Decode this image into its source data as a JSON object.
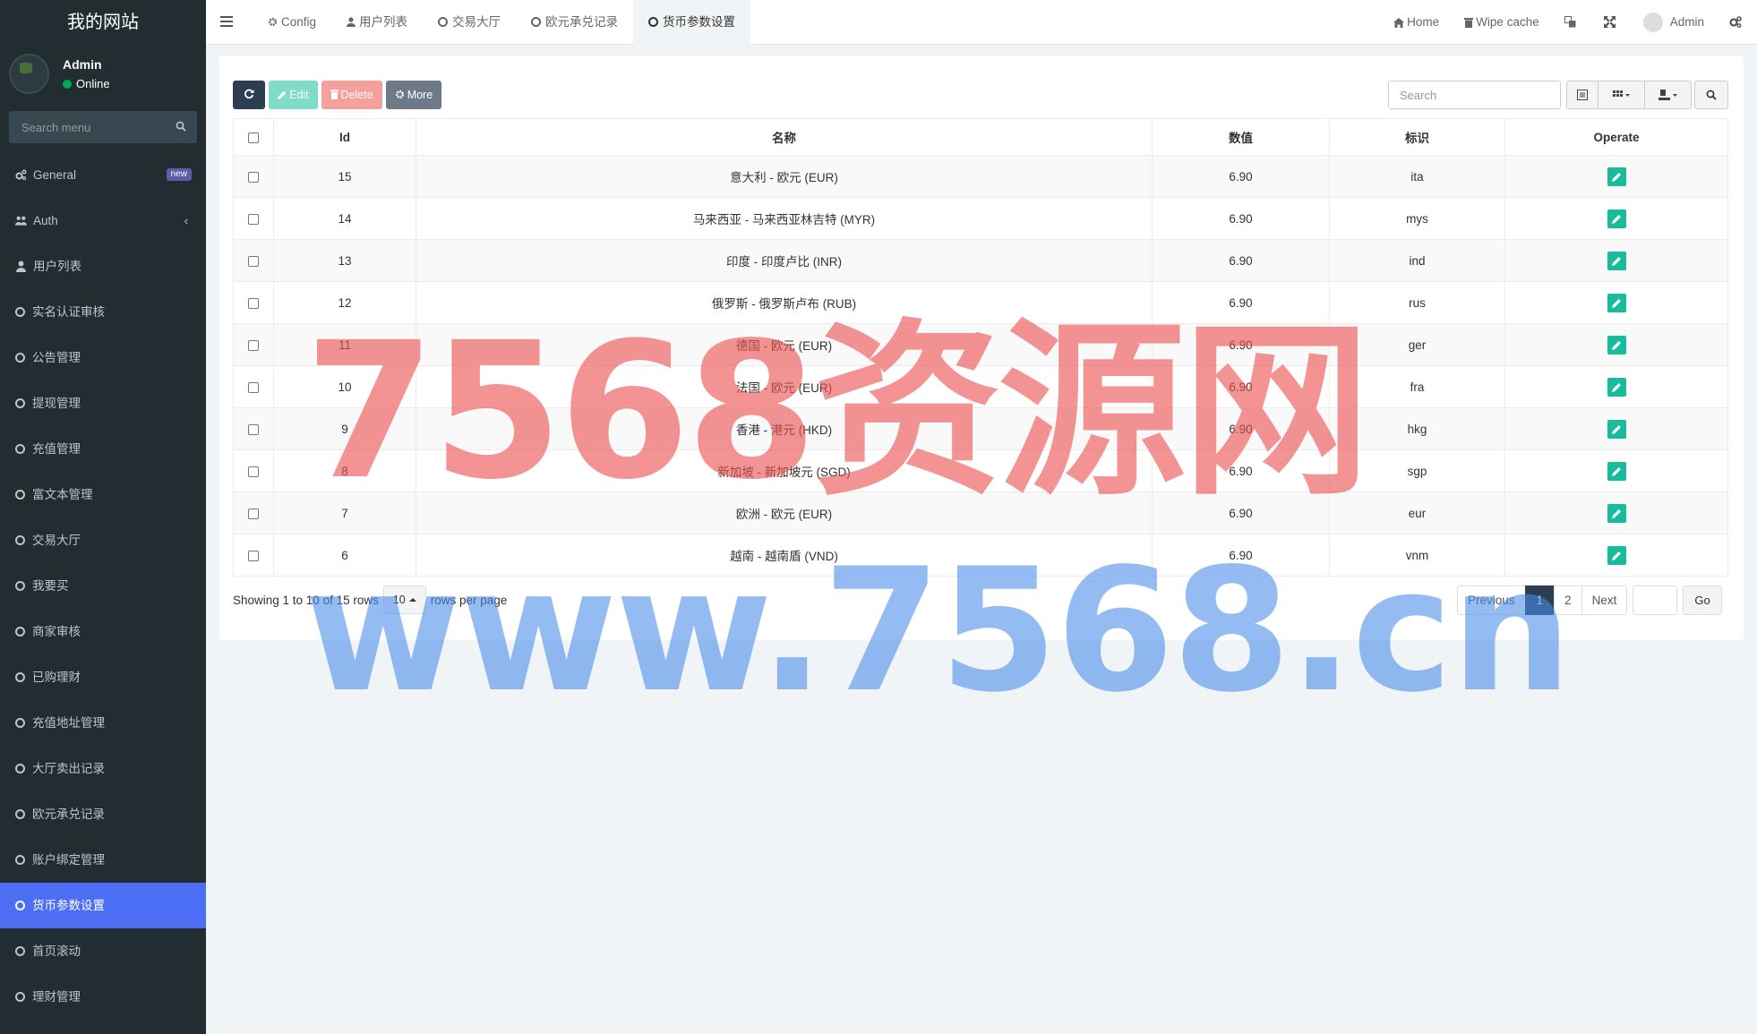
{
  "sidebar": {
    "site_title": "我的网站",
    "user": {
      "name": "Admin",
      "status": "Online"
    },
    "search_placeholder": "Search menu",
    "items": [
      {
        "label": "General",
        "icon": "gears-icon",
        "badge": "new"
      },
      {
        "label": "Auth",
        "icon": "users-icon",
        "chevron": "‹"
      },
      {
        "label": "用户列表",
        "icon": "user-icon"
      },
      {
        "label": "实名认证审核",
        "icon": "circle-icon"
      },
      {
        "label": "公告管理",
        "icon": "circle-icon"
      },
      {
        "label": "提现管理",
        "icon": "circle-icon"
      },
      {
        "label": "充值管理",
        "icon": "circle-icon"
      },
      {
        "label": "富文本管理",
        "icon": "circle-icon"
      },
      {
        "label": "交易大厅",
        "icon": "circle-icon"
      },
      {
        "label": "我要买",
        "icon": "circle-icon"
      },
      {
        "label": "商家审核",
        "icon": "circle-icon"
      },
      {
        "label": "已购理财",
        "icon": "circle-icon"
      },
      {
        "label": "充值地址管理",
        "icon": "circle-icon"
      },
      {
        "label": "大厅卖出记录",
        "icon": "circle-icon"
      },
      {
        "label": "欧元承兑记录",
        "icon": "circle-icon"
      },
      {
        "label": "账户绑定管理",
        "icon": "circle-icon"
      },
      {
        "label": "货币参数设置",
        "icon": "circle-icon",
        "active": true
      },
      {
        "label": "首页滚动",
        "icon": "circle-icon"
      },
      {
        "label": "理财管理",
        "icon": "circle-icon"
      }
    ]
  },
  "topbar": {
    "tabs": [
      {
        "label": "Config",
        "icon": "gear-icon"
      },
      {
        "label": "用户列表",
        "icon": "user-icon"
      },
      {
        "label": "交易大厅",
        "icon": "circle-icon"
      },
      {
        "label": "欧元承兑记录",
        "icon": "circle-icon"
      },
      {
        "label": "货币参数设置",
        "icon": "circle-icon",
        "active": true
      }
    ],
    "home_label": "Home",
    "wipe_label": "Wipe cache",
    "admin_label": "Admin"
  },
  "toolbar": {
    "edit_label": "Edit",
    "delete_label": "Delete",
    "more_label": "More",
    "search_placeholder": "Search"
  },
  "table": {
    "columns": [
      "Id",
      "名称",
      "数值",
      "标识",
      "Operate"
    ],
    "rows": [
      {
        "id": "15",
        "name": "意大利 - 欧元 (EUR)",
        "value": "6.90",
        "code": "ita"
      },
      {
        "id": "14",
        "name": "马来西亚 - 马来西亚林吉特 (MYR)",
        "value": "6.90",
        "code": "mys"
      },
      {
        "id": "13",
        "name": "印度 - 印度卢比 (INR)",
        "value": "6.90",
        "code": "ind"
      },
      {
        "id": "12",
        "name": "俄罗斯 - 俄罗斯卢布 (RUB)",
        "value": "6.90",
        "code": "rus"
      },
      {
        "id": "11",
        "name": "德国 - 欧元 (EUR)",
        "value": "6.90",
        "code": "ger"
      },
      {
        "id": "10",
        "name": "法国 - 欧元 (EUR)",
        "value": "6.90",
        "code": "fra"
      },
      {
        "id": "9",
        "name": "香港 - 港元 (HKD)",
        "value": "6.90",
        "code": "hkg"
      },
      {
        "id": "8",
        "name": "新加坡 - 新加坡元 (SGD)",
        "value": "6.90",
        "code": "sgp"
      },
      {
        "id": "7",
        "name": "欧洲 - 欧元 (EUR)",
        "value": "6.90",
        "code": "eur"
      },
      {
        "id": "6",
        "name": "越南 - 越南盾 (VND)",
        "value": "6.90",
        "code": "vnm"
      }
    ]
  },
  "pagination": {
    "showing_text": "Showing 1 to 10 of 15 rows",
    "page_size": "10",
    "rows_per_page": "rows per page",
    "previous": "Previous",
    "pages": [
      "1",
      "2"
    ],
    "current": "1",
    "next": "Next",
    "go": "Go"
  },
  "watermark": {
    "line1": "7568资源网",
    "line2": "www.7568.cn"
  },
  "colors": {
    "sidebar_bg": "#222d32",
    "active_item": "#4c6ef5",
    "operate_green": "#18bc9c",
    "primary_dark": "#2c3e50"
  }
}
